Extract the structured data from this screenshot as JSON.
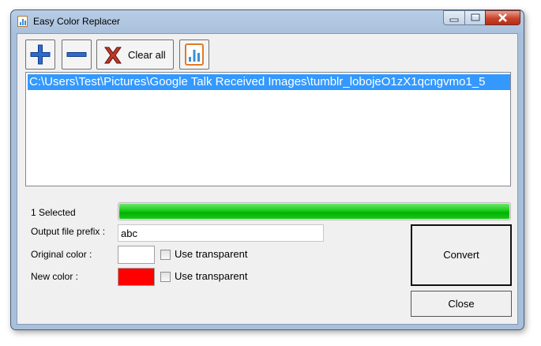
{
  "window": {
    "title": "Easy Color Replacer"
  },
  "toolbar": {
    "clear_all_label": "Clear all"
  },
  "files": [
    "C:\\Users\\Test\\Pictures\\Google Talk Received Images\\tumblr_lobojeO1zX1qcngvmo1_5"
  ],
  "status": {
    "selected_text": "1 Selected",
    "progress_percent": 100
  },
  "form": {
    "prefix_label": "Output file prefix :",
    "prefix_value": "abc",
    "original_color_label": "Original color :",
    "original_color": "#ffffff",
    "new_color_label": "New color :",
    "new_color": "#ff0000",
    "use_transparent_label": "Use transparent",
    "original_use_transparent": false,
    "new_use_transparent": false
  },
  "buttons": {
    "convert": "Convert",
    "close": "Close"
  },
  "colors": {
    "selection": "#3399ff",
    "progress": "#1fd21f"
  }
}
